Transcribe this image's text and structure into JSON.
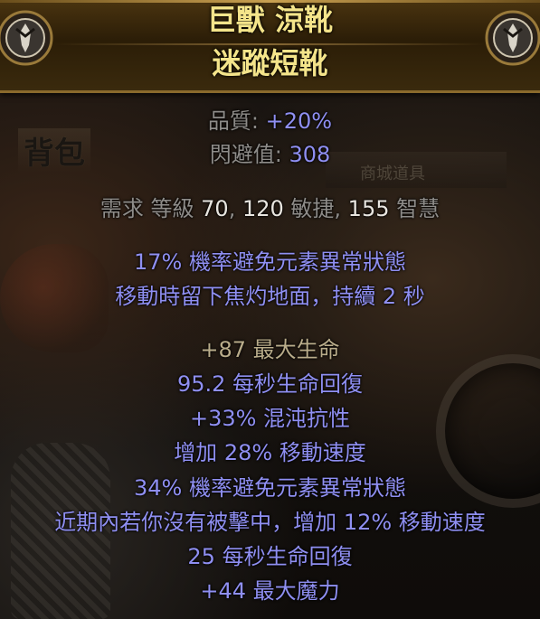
{
  "item": {
    "name_line1": "巨獸 涼靴",
    "name_line2": "迷蹤短靴",
    "quality_label": "品質: ",
    "quality_value": "+20%",
    "evasion_label": "閃避值: ",
    "evasion_value": "308",
    "requirements": {
      "prefix": "需求 等級 ",
      "level": "70",
      "sep1": ", ",
      "dex": "120",
      "dex_label": " 敏捷",
      "sep2": ", ",
      "int": "155",
      "int_label": " 智慧"
    },
    "implicit_mods": [
      "17% 機率避免元素異常狀態",
      "移動時留下焦灼地面，持續 2 秒"
    ],
    "explicit_mods": [
      "+87 最大生命",
      "95.2 每秒生命回復",
      "+33% 混沌抗性",
      "增加 28% 移動速度",
      "34% 機率避免元素異常狀態",
      "近期內若你沒有被擊中，增加 12% 移動速度",
      "25 每秒生命回復",
      "+44 最大魔力"
    ]
  },
  "background": {
    "inventory_label": "背包",
    "vendor_label": "商城道具"
  },
  "colors": {
    "name": "#f4e48a",
    "header_border": "#8a6a2c",
    "magic_text": "#8f8ff2",
    "value_text": "#e9e6e0",
    "label_text": "#8e8c89"
  },
  "icons": [
    "rare-emblem-icon-left",
    "rare-emblem-icon-right"
  ]
}
